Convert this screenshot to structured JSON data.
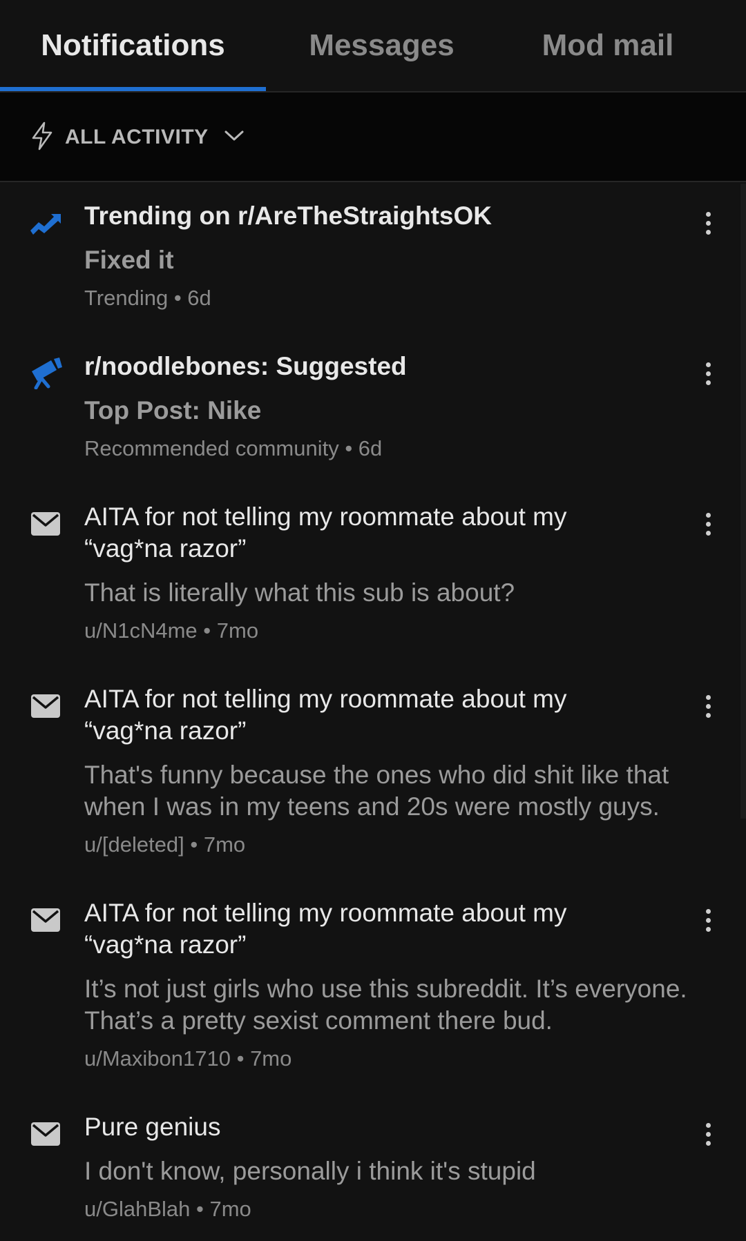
{
  "tabs": [
    {
      "label": "Notifications",
      "active": true
    },
    {
      "label": "Messages",
      "active": false
    },
    {
      "label": "Mod mail",
      "active": false
    }
  ],
  "filter": {
    "label": "ALL ACTIVITY",
    "icon": "bolt-icon",
    "chevron": "chevron-down-icon"
  },
  "colors": {
    "accent": "#1f6fd1",
    "background": "#121212",
    "filter_bg": "#060606"
  },
  "items": [
    {
      "icon": "trending-icon",
      "title": "Trending on r/AreTheStraightsOK",
      "text": "Fixed it",
      "meta": "Trending • 6d"
    },
    {
      "icon": "telescope-icon",
      "title": "r/noodlebones: Suggested",
      "text": "Top Post: Nike",
      "meta": "Recommended community • 6d"
    },
    {
      "icon": "mail-icon",
      "title": "AITA for not telling my roommate about my “vag*na razor”",
      "text": "That is literally what this sub is about?",
      "meta": "u/N1cN4me • 7mo"
    },
    {
      "icon": "mail-icon",
      "title": "AITA for not telling my roommate about my “vag*na razor”",
      "text": "That's funny because the ones who did shit like that when I was in my teens and 20s were mostly guys.",
      "meta": "u/[deleted] • 7mo"
    },
    {
      "icon": "mail-icon",
      "title": "AITA for not telling my roommate about my “vag*na razor”",
      "text": "It’s not just girls who use this subreddit. It’s everyone. That’s a pretty sexist comment there bud.",
      "meta": "u/Maxibon1710 • 7mo"
    },
    {
      "icon": "mail-icon",
      "title": "Pure genius",
      "text": "I don't know, personally i think it's stupid",
      "meta": "u/GlahBlah • 7mo"
    }
  ]
}
